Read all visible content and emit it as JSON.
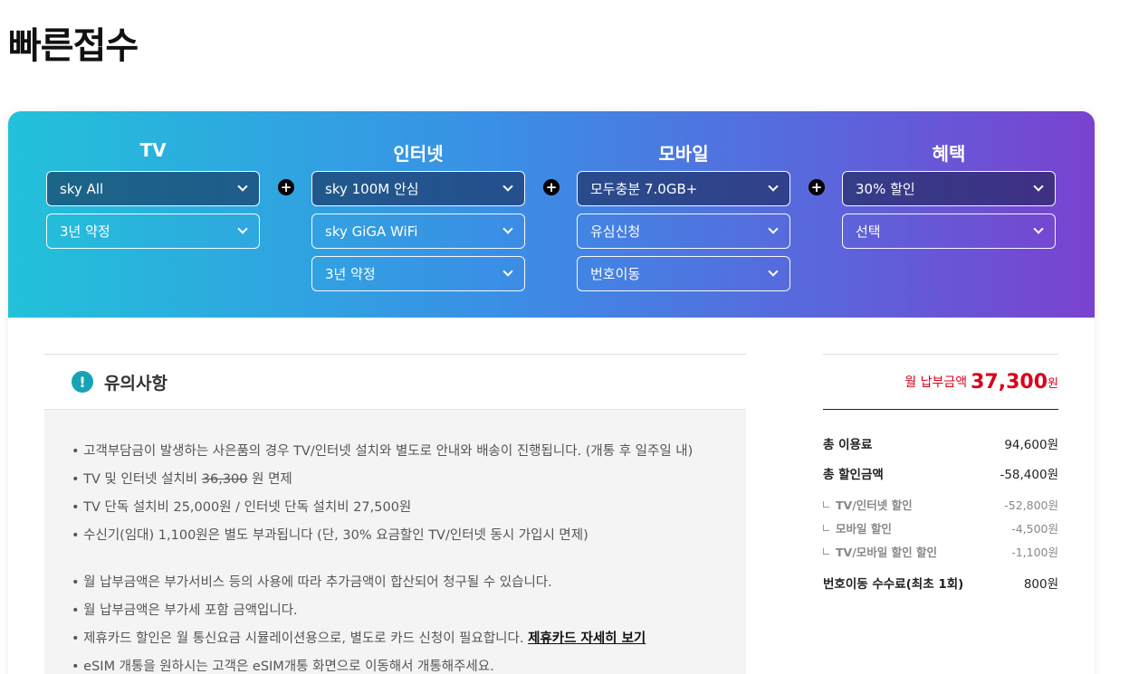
{
  "page": {
    "title": "빠른접수"
  },
  "columns": {
    "tv": {
      "title": "TV",
      "select1": "sky All",
      "select2": "3년 약정"
    },
    "internet": {
      "title": "인터넷",
      "select1": "sky 100M 안심",
      "select2": "sky GiGA WiFi",
      "select3": "3년 약정"
    },
    "mobile": {
      "title": "모바일",
      "select1": "모두충분 7.0GB+",
      "select2": "유심신청",
      "select3": "번호이동"
    },
    "benefit": {
      "title": "혜택",
      "select1": "30% 할인",
      "select2": "선택"
    },
    "plus_symbol": "+"
  },
  "notice": {
    "title": "유의사항",
    "icon_text": "!",
    "items": [
      "• 고객부담금이 발생하는 사은품의 경우 TV/인터넷 설치와 별도로 안내와 배송이 진행됩니다. (개통 후 일주일 내)",
      {
        "prefix": "• TV 및 인터넷 설치비 ",
        "struck": "36,300",
        "suffix": " 원 면제"
      },
      "• TV 단독 설치비 25,000원 / 인터넷 단독 설치비 27,500원",
      "• 수신기(임대) 1,100원은 별도 부과됩니다 (단, 30% 요금할인 TV/인터넷 동시 가입시 면제)",
      "• 월 납부금액은 부가서비스 등의 사용에 따라 추가금액이 합산되어 청구될 수 있습니다.",
      "• 월 납부금액은 부가세 포함 금액입니다.",
      {
        "prefix": "• 제휴카드 할인은 월 통신요금 시뮬레이션용으로, 별도로 카드 신청이 필요합니다. ",
        "link": "제휴카드 자세히 보기"
      },
      "• eSIM 개통을 원하시는 고객은 eSIM개통 화면으로 이동해서 개통해주세요."
    ]
  },
  "summary": {
    "monthly_label": "월 납부금액",
    "monthly_amount": "37,300",
    "monthly_unit": "원",
    "rows": [
      {
        "label": "총 이용료",
        "value": "94,600원"
      },
      {
        "label": "총 할인금액",
        "value": "-58,400원"
      },
      {
        "label": "TV/인터넷 할인",
        "value": "-52,800원"
      },
      {
        "label": "모바일 할인",
        "value": "-4,500원"
      },
      {
        "label": "TV/모바일 할인 할인",
        "value": "-1,100원"
      },
      {
        "label": "번호이동 수수료(최초 1회)",
        "value": "800원"
      }
    ]
  },
  "colors": {
    "accent_red": "#d9001b",
    "warning_teal": "#16a3b6",
    "gradient_start": "#22c1d9",
    "gradient_end": "#7a42cf"
  },
  "icons": [
    "chevron-down-icon",
    "plus-icon",
    "exclamation-icon"
  ]
}
